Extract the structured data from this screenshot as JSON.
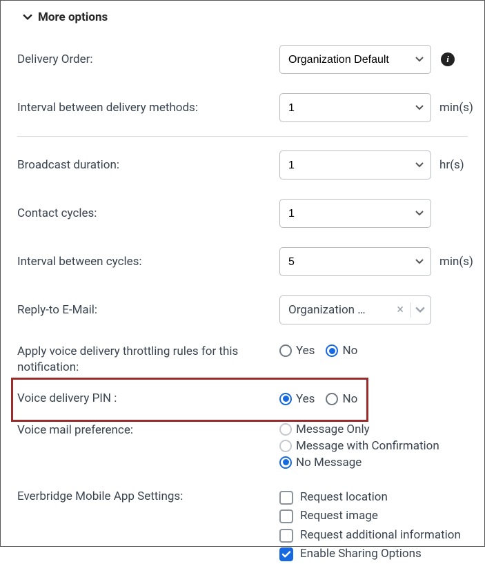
{
  "header": {
    "title": "More options"
  },
  "fields": {
    "delivery_order": {
      "label": "Delivery Order:",
      "value": "Organization Default"
    },
    "interval_methods": {
      "label": "Interval between delivery methods:",
      "value": "1",
      "suffix": "min(s)"
    },
    "broadcast_duration": {
      "label": "Broadcast duration:",
      "value": "1",
      "suffix": "hr(s)"
    },
    "contact_cycles": {
      "label": "Contact cycles:",
      "value": "1"
    },
    "interval_cycles": {
      "label": "Interval between cycles:",
      "value": "5",
      "suffix": "min(s)"
    },
    "reply_to": {
      "label": "Reply-to E-Mail:",
      "value": "Organization …"
    },
    "throttling": {
      "label": "Apply voice delivery throttling rules for this notification:",
      "yes": "Yes",
      "no": "No",
      "selected": "no"
    },
    "voice_pin": {
      "label": "Voice delivery PIN :",
      "yes": "Yes",
      "no": "No",
      "selected": "yes"
    },
    "voicemail": {
      "label": "Voice mail preference:",
      "opts": {
        "message_only": "Message Only",
        "with_confirm": "Message with Confirmation",
        "no_message": "No Message"
      },
      "selected": "no_message"
    },
    "mobile": {
      "label": "Everbridge Mobile App Settings:",
      "request_location": {
        "label": "Request location",
        "checked": false
      },
      "request_image": {
        "label": "Request image",
        "checked": false
      },
      "request_additional": {
        "label": "Request additional information",
        "checked": false
      },
      "enable_sharing": {
        "label": "Enable Sharing Options",
        "checked": true
      }
    }
  }
}
